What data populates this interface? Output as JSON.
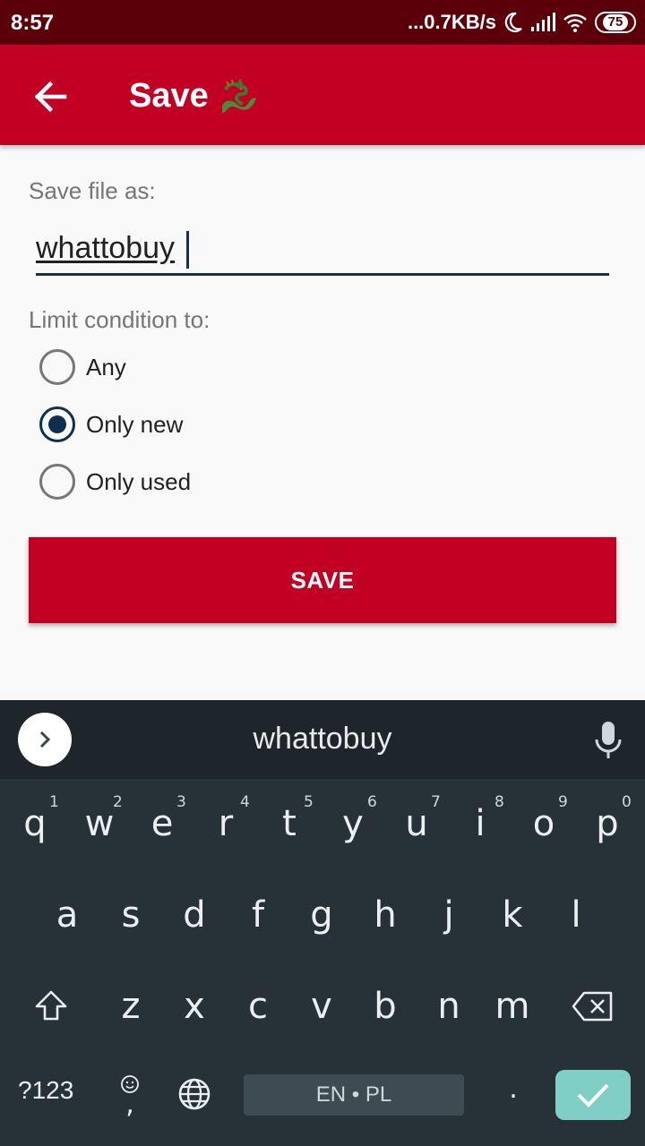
{
  "status_bar": {
    "time": "8:57",
    "network_speed": "...0.7KB/s",
    "battery": "75"
  },
  "toolbar": {
    "title": "Save",
    "back_icon": "arrow-left-icon",
    "emoji_icon": "dragon-icon"
  },
  "form": {
    "save_as_label": "Save file as:",
    "filename_value": "whattobuy",
    "condition_label": "Limit condition to:",
    "options": [
      {
        "label": "Any",
        "checked": false
      },
      {
        "label": "Only new",
        "checked": true
      },
      {
        "label": "Only used",
        "checked": false
      }
    ],
    "save_button": "SAVE"
  },
  "keyboard": {
    "suggestion": "whattobuy",
    "row1": [
      "q",
      "w",
      "e",
      "r",
      "t",
      "y",
      "u",
      "i",
      "o",
      "p"
    ],
    "row1_hints": [
      "1",
      "2",
      "3",
      "4",
      "5",
      "6",
      "7",
      "8",
      "9",
      "0"
    ],
    "row2": [
      "a",
      "s",
      "d",
      "f",
      "g",
      "h",
      "j",
      "k",
      "l"
    ],
    "row3": [
      "z",
      "x",
      "c",
      "v",
      "b",
      "n",
      "m"
    ],
    "symbols_key": "?123",
    "comma_key": ",",
    "period_key": ".",
    "space_label": "EN • PL",
    "colors": {
      "bg": "#263238",
      "accent": "#7fcfc7",
      "primary": "#c10024"
    }
  }
}
